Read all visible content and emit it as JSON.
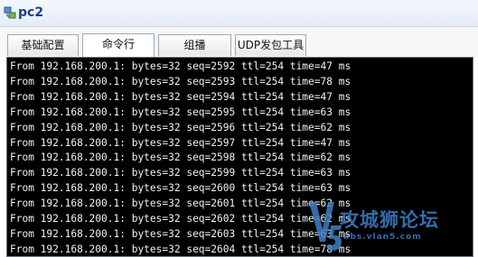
{
  "window": {
    "title": "pc2",
    "icon": "network-pc-icon"
  },
  "tabs": [
    {
      "label": "基础配置",
      "active": false
    },
    {
      "label": "命令行",
      "active": true
    },
    {
      "label": "组播",
      "active": false
    },
    {
      "label": "UDP发包工具",
      "active": false
    }
  ],
  "console": {
    "lines": [
      "From 192.168.200.1: bytes=32 seq=2592 ttl=254 time=47 ms",
      "From 192.168.200.1: bytes=32 seq=2593 ttl=254 time=78 ms",
      "From 192.168.200.1: bytes=32 seq=2594 ttl=254 time=47 ms",
      "From 192.168.200.1: bytes=32 seq=2595 ttl=254 time=63 ms",
      "From 192.168.200.1: bytes=32 seq=2596 ttl=254 time=62 ms",
      "From 192.168.200.1: bytes=32 seq=2597 ttl=254 time=47 ms",
      "From 192.168.200.1: bytes=32 seq=2598 ttl=254 time=62 ms",
      "From 192.168.200.1: bytes=32 seq=2599 ttl=254 time=63 ms",
      "From 192.168.200.1: bytes=32 seq=2600 ttl=254 time=63 ms",
      "From 192.168.200.1: bytes=32 seq=2601 ttl=254 time=62 ms",
      "From 192.168.200.1: bytes=32 seq=2602 ttl=254 time=62 ms",
      "From 192.168.200.1: bytes=32 seq=2603 ttl=254 time=63 ms",
      "From 192.168.200.1: bytes=32 seq=2604 ttl=254 time=78 ms"
    ]
  },
  "watermark": {
    "logo": "V5",
    "text": "攻城狮论坛",
    "sub": "bbs.vlan5.com",
    "color": "#3f7ec4"
  }
}
